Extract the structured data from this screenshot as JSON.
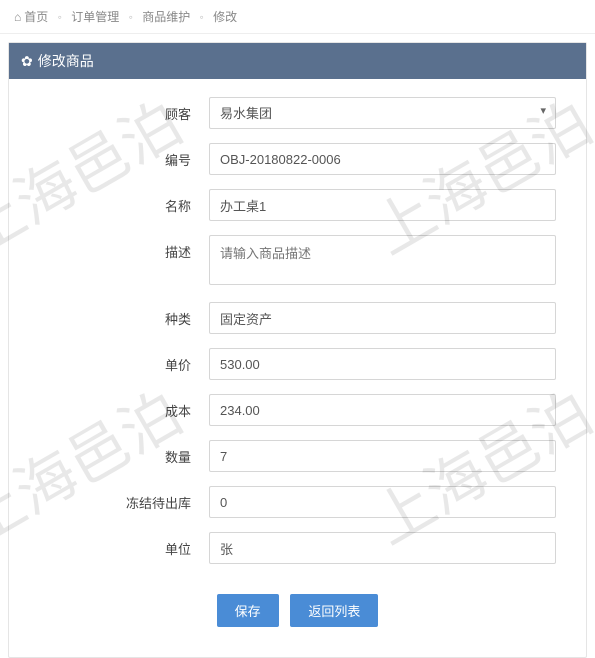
{
  "breadcrumb": {
    "home": "首页",
    "order_mgmt": "订单管理",
    "product_maint": "商品维护",
    "edit": "修改"
  },
  "panel": {
    "title": "修改商品"
  },
  "form": {
    "labels": {
      "customer": "顾客",
      "code": "编号",
      "name": "名称",
      "description": "描述",
      "category": "种类",
      "unit_price": "单价",
      "cost": "成本",
      "quantity": "数量",
      "frozen_out": "冻结待出库",
      "unit": "单位"
    },
    "values": {
      "customer": "易水集团",
      "code": "OBJ-20180822-0006",
      "name": "办工桌1",
      "description_placeholder": "请输入商品描述",
      "category": "固定资产",
      "unit_price": "530.00",
      "cost": "234.00",
      "quantity": "7",
      "frozen_out": "0",
      "unit": "张"
    }
  },
  "actions": {
    "save": "保存",
    "back": "返回列表"
  },
  "watermark": "上海邑泊"
}
